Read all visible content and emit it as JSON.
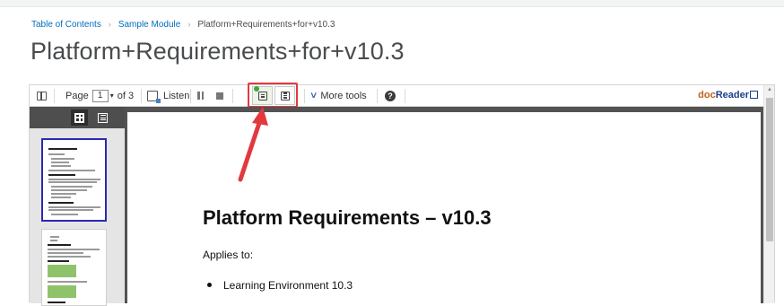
{
  "breadcrumb": {
    "items": [
      "Table of Contents",
      "Sample Module",
      "Platform+Requirements+for+v10.3"
    ],
    "separator": "›"
  },
  "page_title": "Platform+Requirements+for+v10.3",
  "toolbar": {
    "page_label": "Page",
    "page_value": "1",
    "page_dropdown": "▾",
    "page_total": "of 3",
    "listen_label": "Listen",
    "more_tools_chevron": "∨",
    "more_tools_label": "More tools",
    "help_glyph": "?",
    "brand_part1": "doc",
    "brand_part2": "Reader"
  },
  "thumbnails": {
    "pages": [
      "1",
      "2"
    ],
    "selected": "1"
  },
  "document": {
    "title": "Platform Requirements – v10.3",
    "applies_to": "Applies to:",
    "bullets": [
      "Learning Environment 10.3"
    ]
  },
  "colors": {
    "link": "#006fbf",
    "highlight_box": "#e2393f",
    "arrow": "#e2393f",
    "thumb_selected": "#2a2ab0",
    "brand_orange": "#c0601b",
    "brand_blue": "#1b3f8b"
  },
  "icons": [
    "sidebar-toggle-icon",
    "listen-icon",
    "pause-icon",
    "stop-icon",
    "single-page-view-icon",
    "text-view-icon",
    "chevron-down-icon",
    "help-icon",
    "docreader-logo-icon",
    "thumbnail-grid-icon",
    "thumbnail-list-icon"
  ]
}
